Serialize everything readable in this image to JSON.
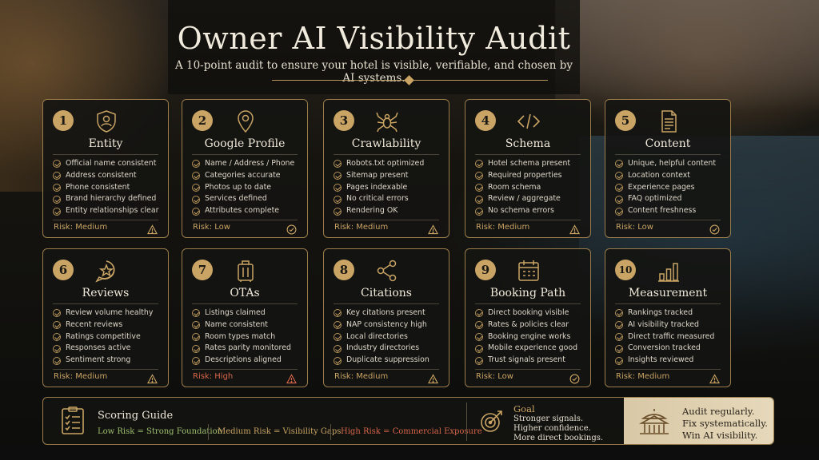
{
  "header": {
    "title": "Owner AI Visibility Audit",
    "subtitle": "A 10-point audit to ensure your hotel is visible, verifiable, and chosen by AI systems."
  },
  "colors": {
    "accent_gold": "#c9a464",
    "risk_low": "#9ec06f",
    "risk_medium": "#c9a464",
    "risk_high": "#d8664a"
  },
  "cards": [
    {
      "number": "1",
      "title": "Entity",
      "icon": "shield-person-icon",
      "items": [
        "Official name consistent",
        "Address consistent",
        "Phone consistent",
        "Brand hierarchy defined",
        "Entity relationships clear"
      ],
      "risk": "Risk: Medium",
      "risk_icon": "warning-icon"
    },
    {
      "number": "2",
      "title": "Google Profile",
      "icon": "map-pin-icon",
      "items": [
        "Name / Address / Phone",
        "Categories accurate",
        "Photos up to date",
        "Services defined",
        "Attributes complete"
      ],
      "risk": "Risk: Low",
      "risk_icon": "check-circle-icon"
    },
    {
      "number": "3",
      "title": "Crawlability",
      "icon": "spider-icon",
      "items": [
        "Robots.txt optimized",
        "Sitemap present",
        "Pages indexable",
        "No critical errors",
        "Rendering OK"
      ],
      "risk": "Risk: Medium",
      "risk_icon": "warning-icon"
    },
    {
      "number": "4",
      "title": "Schema",
      "icon": "code-icon",
      "items": [
        "Hotel schema present",
        "Required properties",
        "Room schema",
        "Review / aggregate",
        "No schema errors"
      ],
      "risk": "Risk: Medium",
      "risk_icon": "warning-icon"
    },
    {
      "number": "5",
      "title": "Content",
      "icon": "document-icon",
      "items": [
        "Unique, helpful content",
        "Location context",
        "Experience pages",
        "FAQ optimized",
        "Content freshness"
      ],
      "risk": "Risk: Low",
      "risk_icon": "check-circle-icon"
    },
    {
      "number": "6",
      "title": "Reviews",
      "icon": "star-bubble-icon",
      "items": [
        "Review volume healthy",
        "Recent reviews",
        "Ratings competitive",
        "Responses active",
        "Sentiment strong"
      ],
      "risk": "Risk: Medium",
      "risk_icon": "warning-icon"
    },
    {
      "number": "7",
      "title": "OTAs",
      "icon": "luggage-icon",
      "items": [
        "Listings claimed",
        "Name consistent",
        "Room types match",
        "Rates parity monitored",
        "Descriptions aligned"
      ],
      "risk": "Risk: High",
      "risk_icon": "warning-icon"
    },
    {
      "number": "8",
      "title": "Citations",
      "icon": "share-icon",
      "items": [
        "Key citations present",
        "NAP consistency high",
        "Local directories",
        "Industry directories",
        "Duplicate suppression"
      ],
      "risk": "Risk: Medium",
      "risk_icon": "warning-icon"
    },
    {
      "number": "9",
      "title": "Booking Path",
      "icon": "calendar-icon",
      "items": [
        "Direct booking visible",
        "Rates & policies clear",
        "Booking engine works",
        "Mobile experience good",
        "Trust signals present"
      ],
      "risk": "Risk: Low",
      "risk_icon": "check-circle-icon"
    },
    {
      "number": "10",
      "title": "Measurement",
      "icon": "bar-chart-icon",
      "items": [
        "Rankings tracked",
        "AI visibility tracked",
        "Direct traffic measured",
        "Conversion tracked",
        "Insights reviewed"
      ],
      "risk": "Risk: Medium",
      "risk_icon": "warning-icon"
    }
  ],
  "footer": {
    "scoring_title": "Scoring Guide",
    "scoring_icon": "checklist-icon",
    "low": "Low Risk = Strong Foundation",
    "medium": "Medium Risk = Visibility Gaps",
    "high": "High Risk = Commercial Exposure",
    "goal_icon": "target-icon",
    "goal_title": "Goal",
    "goal_lines": [
      "Stronger signals.",
      "Higher confidence.",
      "More direct bookings."
    ],
    "cta_icon": "pavilion-icon",
    "cta_lines": [
      "Audit regularly.",
      "Fix systematically.",
      "Win AI visibility."
    ]
  }
}
